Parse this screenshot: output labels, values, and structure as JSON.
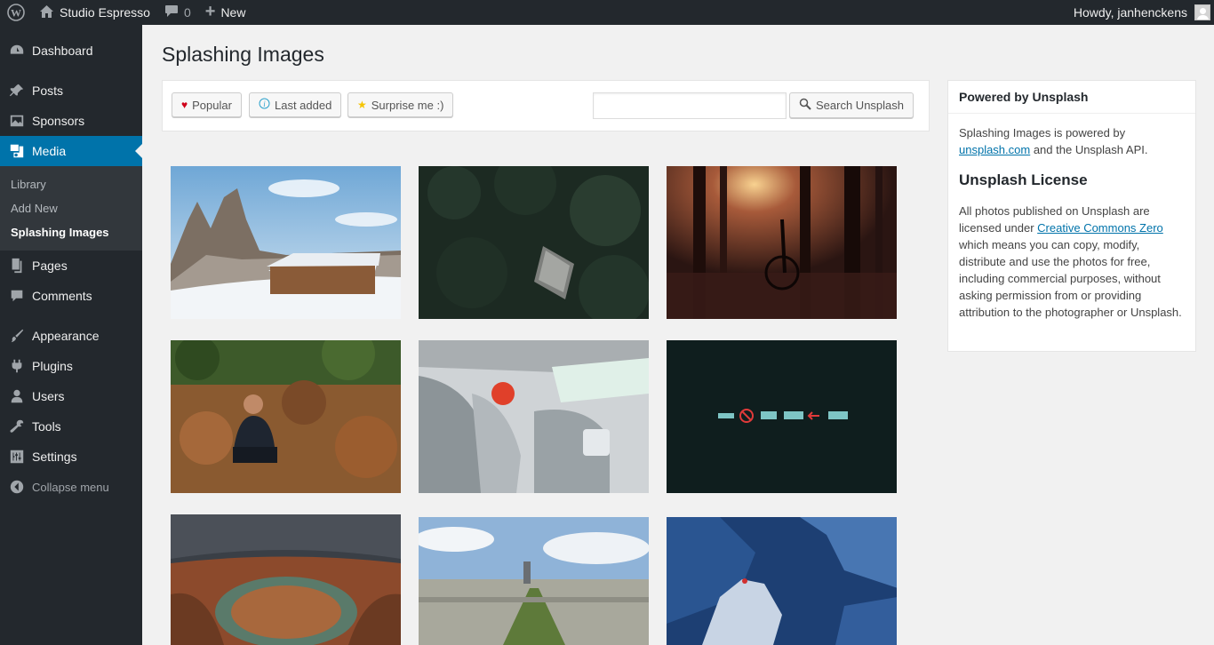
{
  "adminbar": {
    "site_name": "Studio Espresso",
    "comments_count": "0",
    "new_label": "New",
    "howdy": "Howdy, janhenckens"
  },
  "sidebar": {
    "items": [
      {
        "label": "Dashboard",
        "icon": "dashboard-icon"
      },
      {
        "label": "Posts",
        "icon": "pin-icon"
      },
      {
        "label": "Sponsors",
        "icon": "image-icon"
      },
      {
        "label": "Media",
        "icon": "media-icon"
      },
      {
        "label": "Pages",
        "icon": "pages-icon"
      },
      {
        "label": "Comments",
        "icon": "comment-icon"
      },
      {
        "label": "Appearance",
        "icon": "brush-icon"
      },
      {
        "label": "Plugins",
        "icon": "plugin-icon"
      },
      {
        "label": "Users",
        "icon": "user-icon"
      },
      {
        "label": "Tools",
        "icon": "wrench-icon"
      },
      {
        "label": "Settings",
        "icon": "settings-icon"
      }
    ],
    "submenu": [
      "Library",
      "Add New",
      "Splashing Images"
    ],
    "collapse_label": "Collapse menu"
  },
  "page": {
    "title": "Splashing Images"
  },
  "toolbar": {
    "popular_label": "Popular",
    "last_added_label": "Last added",
    "surprise_label": "Surprise me :)",
    "search_value": "",
    "search_button_label": "Search Unsplash"
  },
  "widget": {
    "title": "Powered by Unsplash",
    "intro_before": "Splashing Images is powered by ",
    "intro_link": "unsplash.com",
    "intro_after": " and the Unsplash API.",
    "license_title": "Unsplash License",
    "license_before": "All photos published on Unsplash are licensed under ",
    "license_link": "Creative Commons Zero",
    "license_after": " which means you can copy, modify, distribute and use the photos for free, including commercial purposes, without asking permission from or providing attribution to the photographer or Unsplash."
  },
  "colors": {
    "admin_dark": "#23282d",
    "accent": "#0073aa",
    "submenu_bg": "#32373c",
    "page_bg": "#f1f1f1"
  }
}
